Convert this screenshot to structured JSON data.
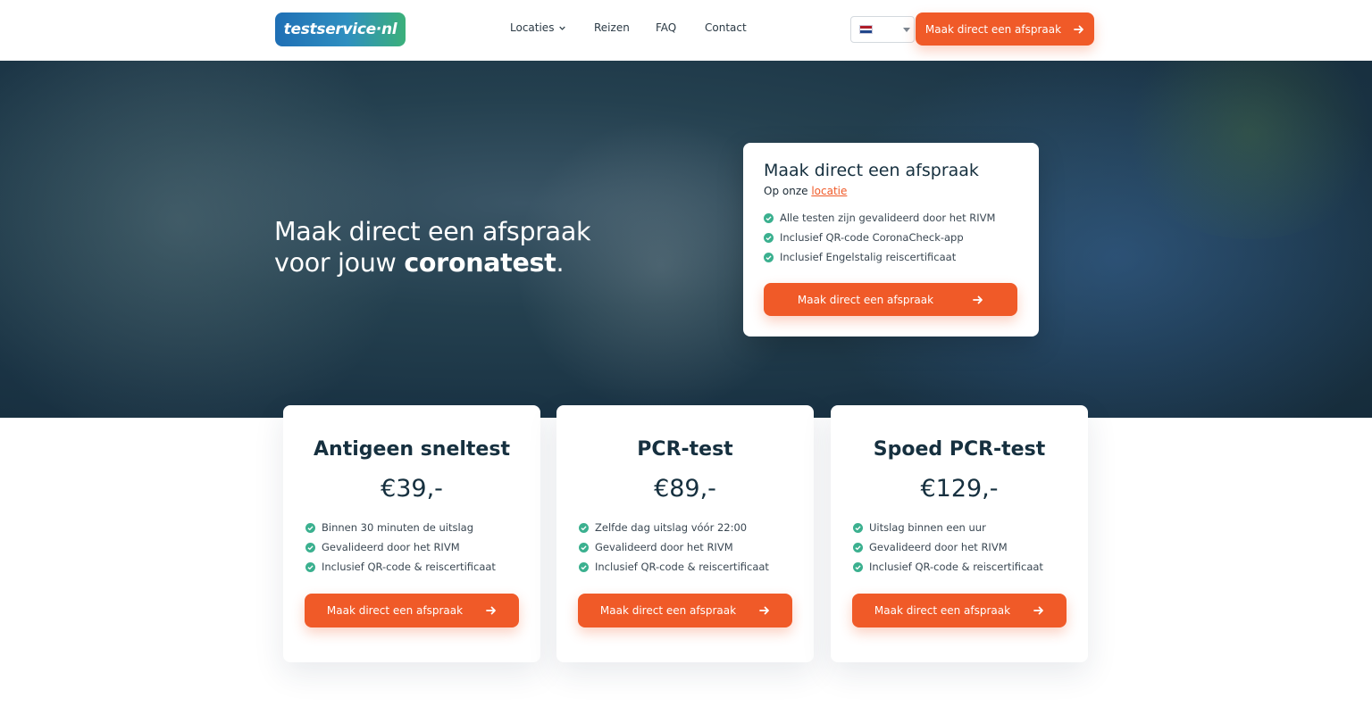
{
  "header": {
    "logo": "testservice·nl",
    "nav": [
      {
        "label": "Locaties",
        "dropdown": true
      },
      {
        "label": "Reizen",
        "dropdown": false
      },
      {
        "label": "FAQ",
        "dropdown": false
      },
      {
        "label": "Contact",
        "dropdown": false
      }
    ],
    "language": {
      "flag": "nl-flag-icon"
    },
    "cta_label": "Maak direct een afspraak"
  },
  "hero": {
    "title_line1": "Maak direct een afspraak",
    "title_line2_prefix": "voor jouw ",
    "title_line2_bold": "coronatest",
    "title_line2_suffix": "."
  },
  "hero_card": {
    "title": "Maak direct een afspraak",
    "subtitle_prefix": "Op onze ",
    "subtitle_link": "locatie",
    "features": [
      "Alle testen zijn gevalideerd door het RIVM",
      "Inclusief QR-code CoronaCheck-app",
      "Inclusief Engelstalig reiscertificaat"
    ],
    "cta_label": "Maak direct een afspraak"
  },
  "cards": [
    {
      "title": "Antigeen sneltest",
      "price": "€39,-",
      "features": [
        "Binnen 30 minuten de uitslag",
        "Gevalideerd door het RIVM",
        "Inclusief QR-code & reiscertificaat"
      ],
      "cta_label": "Maak direct een afspraak"
    },
    {
      "title": "PCR-test",
      "price": "€89,-",
      "features": [
        "Zelfde dag uitslag vóór 22:00",
        "Gevalideerd door het RIVM",
        "Inclusief QR-code & reiscertificaat"
      ],
      "cta_label": "Maak direct een afspraak"
    },
    {
      "title": "Spoed PCR-test",
      "price": "€129,-",
      "features": [
        "Uitslag binnen een uur",
        "Gevalideerd door het RIVM",
        "Inclusief QR-code & reiscertificaat"
      ],
      "cta_label": "Maak direct een afspraak"
    }
  ],
  "colors": {
    "accent": "#f05a28",
    "check": "#3bb08f",
    "heading": "#16303f"
  }
}
